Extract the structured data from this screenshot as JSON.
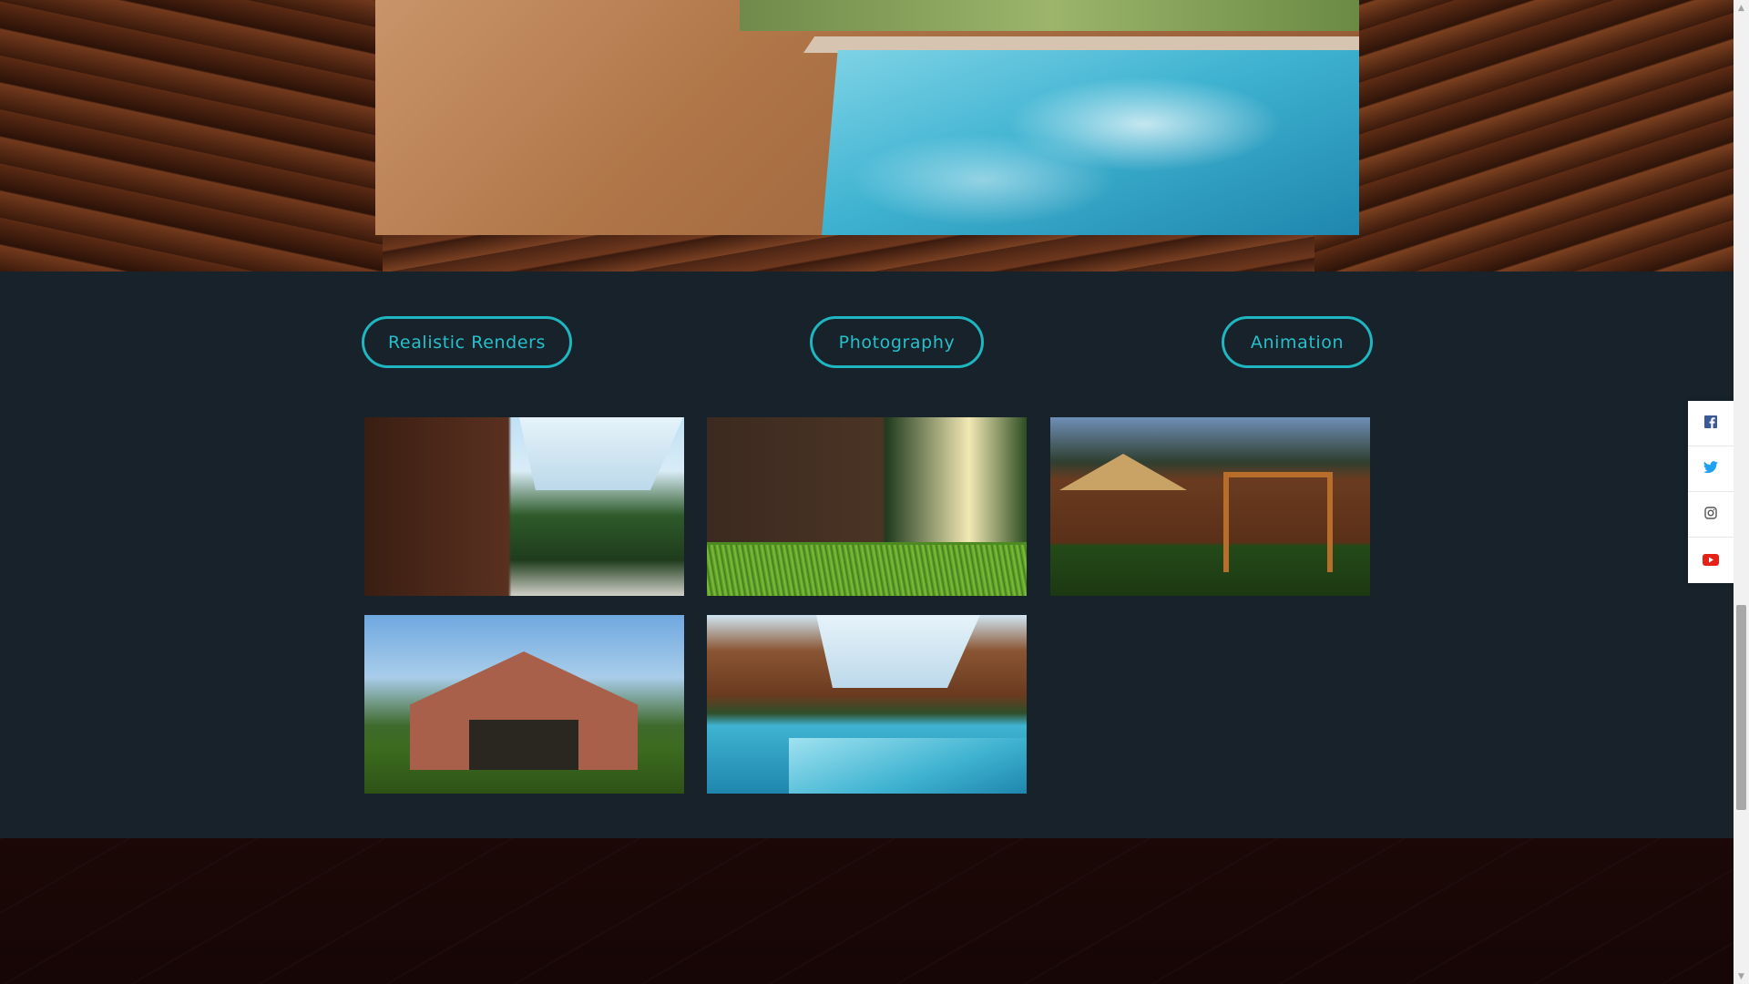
{
  "filters": {
    "realistic_renders": "Realistic Renders",
    "photography": "Photography",
    "animation": "Animation"
  },
  "gallery": {
    "items": [
      {
        "name": "pool-house-interior-wood-wall"
      },
      {
        "name": "glass-house-grass-sunlight"
      },
      {
        "name": "garden-umbrella-swing-night"
      },
      {
        "name": "brick-pool-house-exterior"
      },
      {
        "name": "indoor-pool-skylight"
      }
    ]
  },
  "social": {
    "items": [
      {
        "icon": "facebook-icon",
        "color": "#3b5998"
      },
      {
        "icon": "twitter-icon",
        "color": "#1da1f2"
      },
      {
        "icon": "instagram-icon",
        "color": "#555555"
      },
      {
        "icon": "youtube-icon",
        "color": "#e62117"
      }
    ]
  },
  "colors": {
    "accent": "#1fb6c1",
    "section_bg": "#17222a"
  }
}
